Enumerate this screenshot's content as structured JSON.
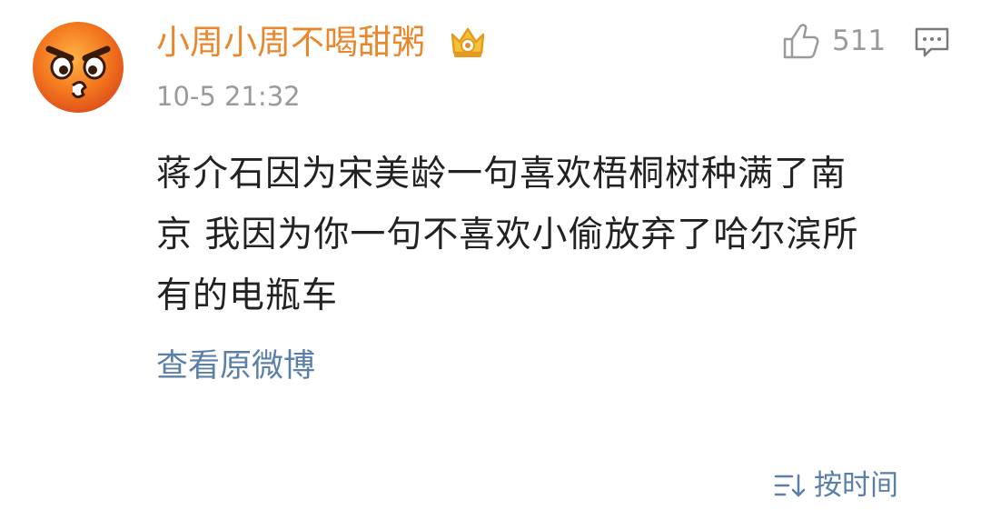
{
  "comment": {
    "author": "小周小周不喝甜粥",
    "timestamp": "10-5 21:32",
    "likes": "511",
    "text_lines": [
      "蒋介石因为宋美龄一句喜欢梧桐树种满了南",
      "京 我因为你一句不喜欢小偷放弃了哈尔滨所",
      "有的电瓶车"
    ],
    "view_original": "查看原微博"
  },
  "footer": {
    "sort_label": "按时间"
  },
  "icons": {
    "avatar": "angry-face-emoji-avatar",
    "badge": "crown-vip-icon",
    "like": "thumbs-up-icon",
    "comment": "comment-icon",
    "sort": "sort-icon"
  },
  "colors": {
    "author": "#e8872b",
    "link": "#5a7fa8",
    "meta": "#9a9a9a",
    "text": "#222222"
  }
}
